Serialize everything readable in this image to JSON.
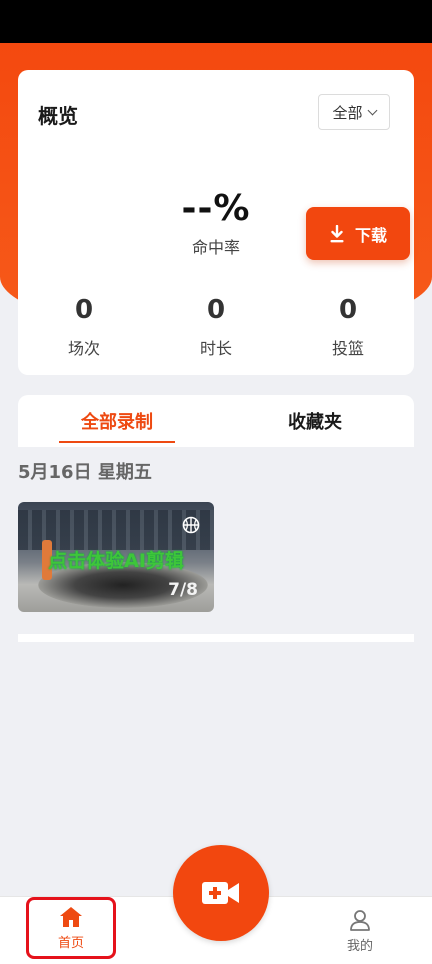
{
  "overview": {
    "title": "概览",
    "filter_label": "全部",
    "hit_rate_value": "--%",
    "hit_rate_label": "命中率",
    "stats": [
      {
        "value": "0",
        "label": "场次"
      },
      {
        "value": "0",
        "label": "时长"
      },
      {
        "value": "0",
        "label": "投篮"
      }
    ]
  },
  "download_button": {
    "label": "下载"
  },
  "tabs": [
    {
      "label": "全部录制",
      "active": true
    },
    {
      "label": "收藏夹",
      "active": false
    }
  ],
  "recordings": {
    "date": "5月16日 星期五",
    "items": [
      {
        "overlay_text": "点击体验AI剪辑",
        "count": "7/8"
      }
    ]
  },
  "bottom_nav": {
    "home_label": "首页",
    "mine_label": "我的"
  },
  "colors": {
    "accent": "#f2470f",
    "highlight_box": "#e5121b"
  },
  "icons": {
    "download": "download-icon",
    "basketball": "basketball-icon",
    "record": "video-camera-plus-icon",
    "home": "home-icon",
    "mine": "person-icon"
  }
}
